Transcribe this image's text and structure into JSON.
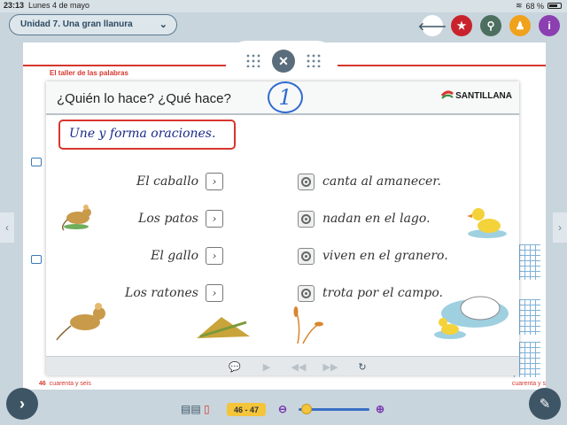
{
  "status": {
    "time": "23:13",
    "date": "Lunes 4 de mayo",
    "battery": "68 %"
  },
  "unit_selector": {
    "label": "Unidad 7. Una gran llanura"
  },
  "book": {
    "section_title": "El taller de las palabras",
    "left_page_number": "46",
    "left_page_words": "cuarenta y seis",
    "right_page_words": "cuarenta y s"
  },
  "modal": {
    "title": "¿Quién lo hace? ¿Qué hace?",
    "activity_number": "1",
    "publisher": "SANTILLANA",
    "instruction": "Une y forma oraciones.",
    "left_items": [
      "El caballo",
      "Los patos",
      "El gallo",
      "Los ratones"
    ],
    "right_items": [
      "canta al amanecer.",
      "nadan en el lago.",
      "viven en el granero.",
      "trota por el campo."
    ]
  },
  "bottom": {
    "pages": "46 - 47",
    "zoom_level": 0.05
  },
  "colors": {
    "accent_red": "#d6362e",
    "header_blue": "#2d4b63",
    "badge_yellow": "#f4c53b",
    "purple": "#7a3ab0"
  }
}
